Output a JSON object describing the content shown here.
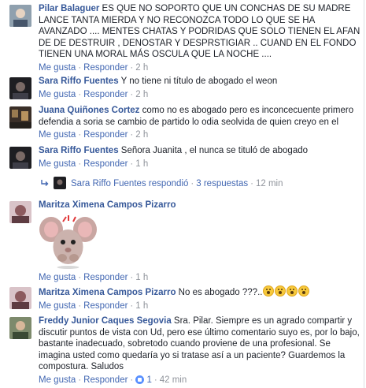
{
  "actions": {
    "like": "Me gusta",
    "reply": "Responder"
  },
  "comments": [
    {
      "author": "Pilar Balaguer",
      "text": " ES QUE NO SOPORTO QUE UN CONCHAS DE SU MADRE LANCE TANTA MIERDA Y NO RECONOZCA TODO LO QUE SE HA AVANZADO .... MENTES CHATAS Y PODRIDAS QUE SOLO TIENEN EL AFAN DE DE DESTRUIR , DENOSTAR Y DESPRSTIGIAR .. CUAND EN EL FONDO TIENEN UNA MORAL MÁS OSCULA QUE LA NOCHE ....",
      "time": "2 h",
      "avatar_color": "#6d7a86"
    },
    {
      "author": "Sara Riffo Fuentes",
      "text": " Y no tiene ni título de abogado el weon",
      "time": "2 h",
      "avatar_color": "#2b2b2e"
    },
    {
      "author": "Juana Quiñones Cortez",
      "text": " como no es abogado pero es inconcecuente primero defendia a soria se cambio de partido lo odia seolvida de quien creyo en el",
      "time": "2 h",
      "avatar_color": "#3a2f28"
    },
    {
      "author": "Sara Riffo Fuentes",
      "text": " Señora Juanita , el nunca se tituló de abogado",
      "time": "1 h",
      "avatar_color": "#2b2b2e"
    },
    {
      "author": "Maritza Ximena Campos Pizarro",
      "text": "",
      "time": "1 h",
      "avatar_color": "#8c5a5e"
    },
    {
      "author": "Maritza Ximena Campos Pizarro",
      "text": " No es abogado ???..",
      "time": "1 h",
      "avatar_color": "#8c5a5e"
    },
    {
      "author": "Freddy Junior Caques Segovia",
      "text": " Sra. Pilar. Siempre es un agrado compartir y discutir puntos de vista con Ud, pero ese último comentario suyo es, por lo bajo, bastante inadecuado, sobretodo cuando proviene de una profesional. Se imagina usted como quedaría yo si tratase así a un paciente? Guardemos la compostura. Saludos",
      "time": "42 min",
      "likes": "1",
      "avatar_color": "#5b6b4e"
    }
  ],
  "reply_summary": {
    "author": "Sara Riffo Fuentes",
    "verb": "respondió",
    "count": "3 respuestas",
    "time": "12 min"
  }
}
